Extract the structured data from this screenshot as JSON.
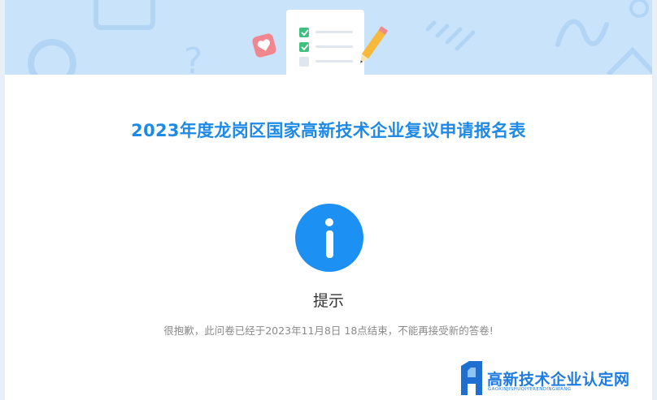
{
  "survey": {
    "title": "2023年度龙岗区国家高新技术企业复议申请报名表"
  },
  "notice": {
    "icon": "info-icon",
    "heading": "提示",
    "message": "很抱歉，此问卷已经于2023年11月8日 18点结束，不能再接受新的答卷!"
  },
  "watermark": {
    "text": "高新技术企业认定网",
    "subtext": "GAOXINJISHUQIYERENDINGWANG"
  },
  "colors": {
    "accent": "#1e8ae6",
    "info_circle": "#1c90f3",
    "banner": "#c9e3fb"
  }
}
